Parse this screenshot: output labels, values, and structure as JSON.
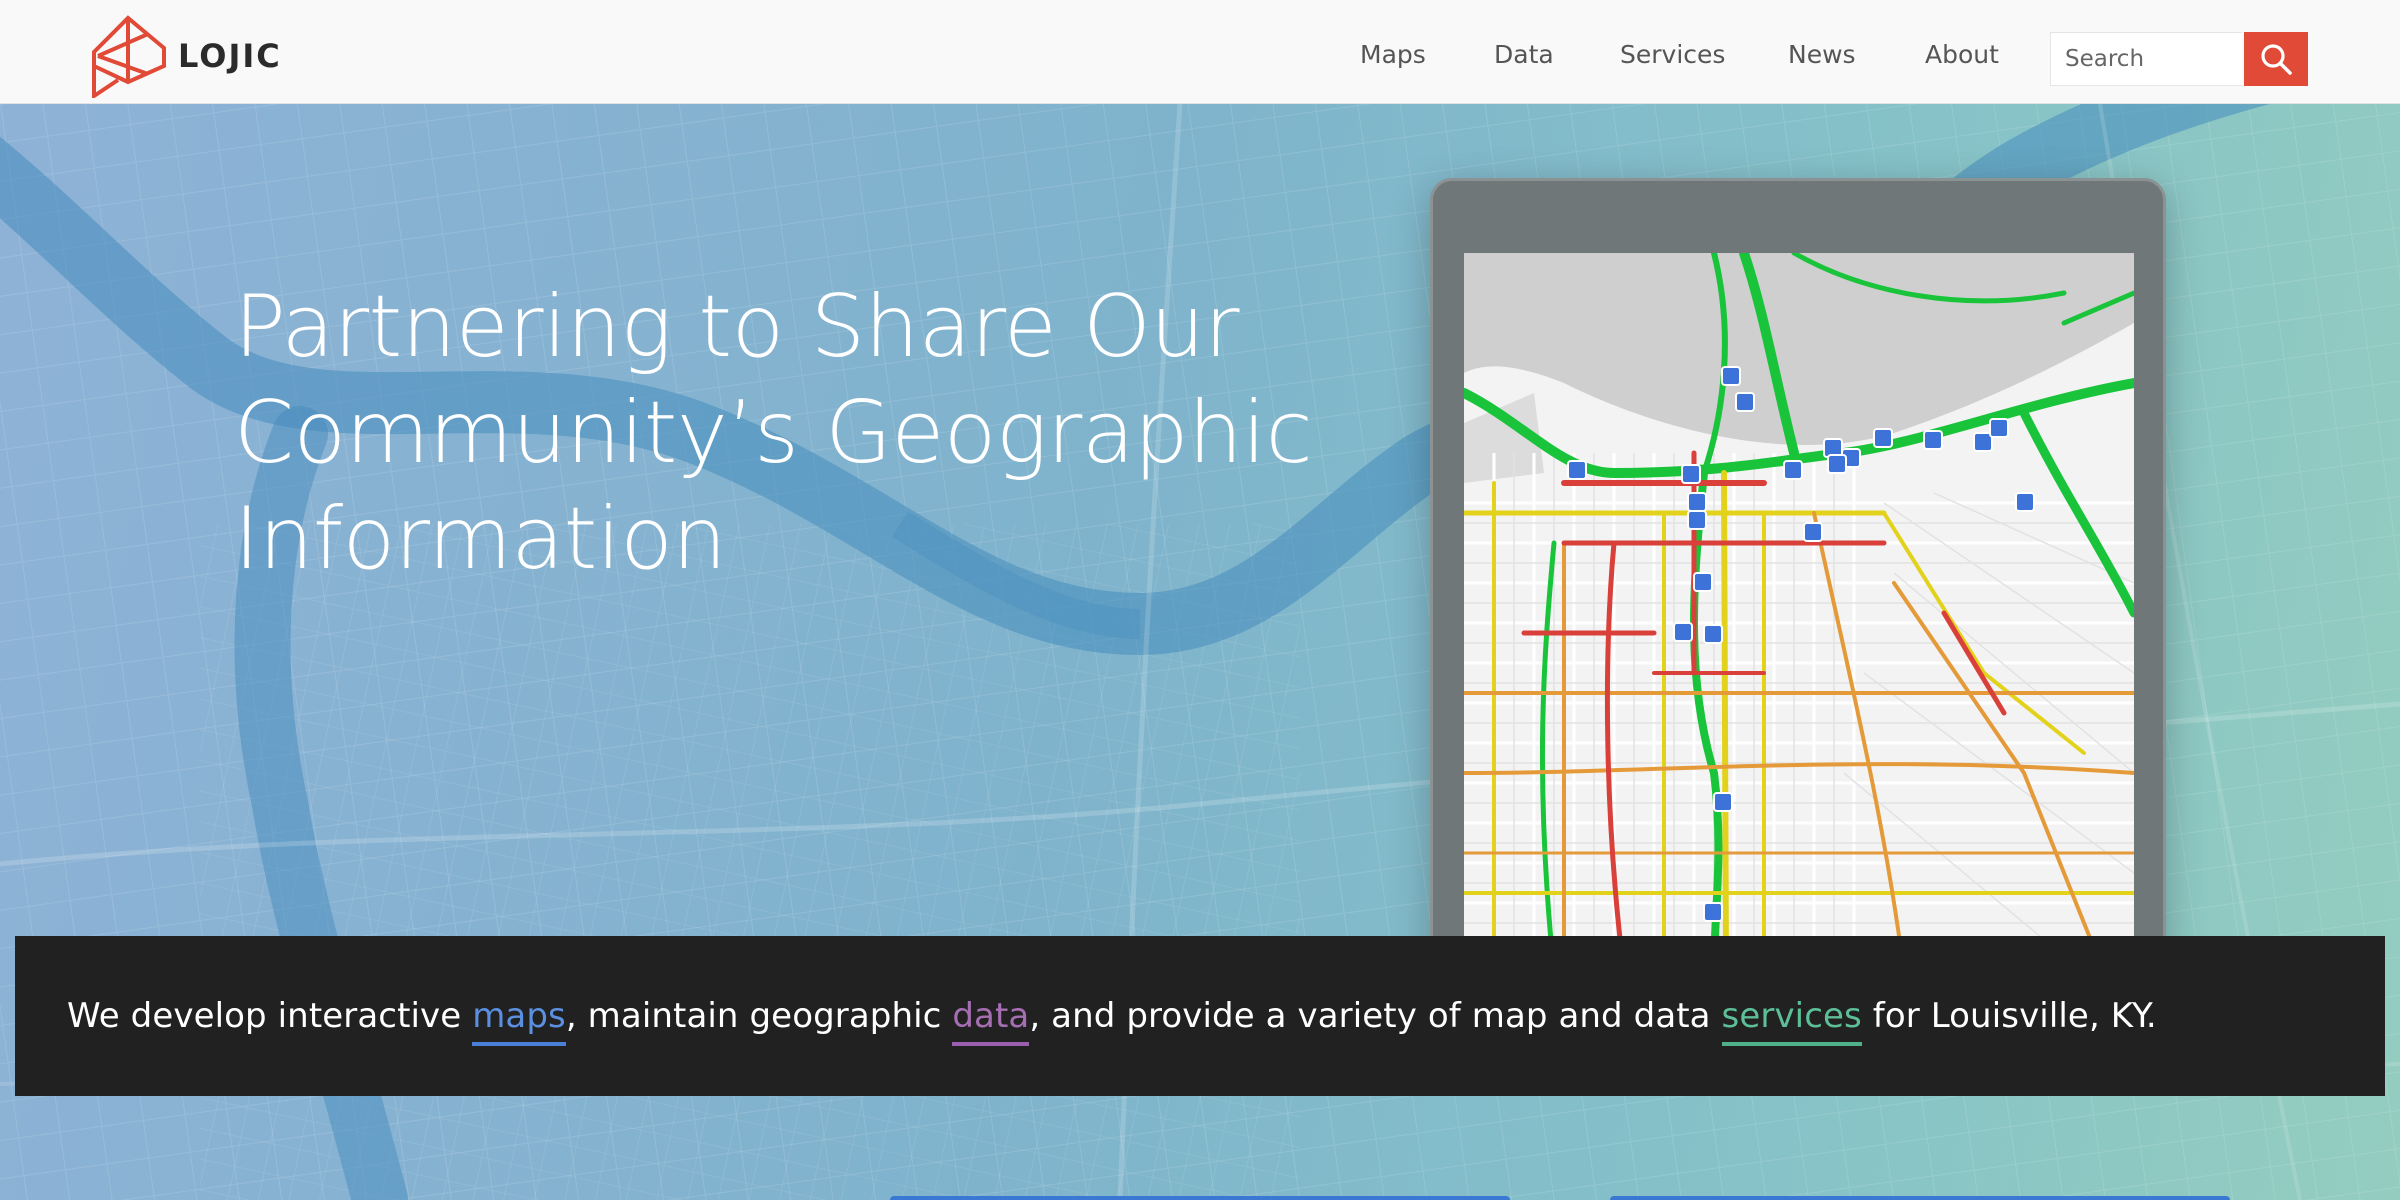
{
  "brand": {
    "name": "LOJIC",
    "logo_color": "#e04a36"
  },
  "nav": {
    "items": [
      {
        "label": "Maps"
      },
      {
        "label": "Data"
      },
      {
        "label": "Services"
      },
      {
        "label": "News"
      },
      {
        "label": "About"
      }
    ],
    "search": {
      "placeholder": "Search",
      "button_icon": "search-icon",
      "button_color": "#e04a36"
    }
  },
  "hero": {
    "headline_lines": [
      "Partnering to Share Our",
      "Community’s Geographic",
      "Information"
    ],
    "tablet_icon": "traffic-map-image"
  },
  "banner": {
    "text_1": "We develop interactive ",
    "link_maps": "maps",
    "text_2": ", maintain geographic ",
    "link_data": "data",
    "text_3": ", and provide a variety of map and data ",
    "link_services": "services",
    "text_4": " for Louisville, KY.",
    "colors": {
      "maps": "#4a7fd8",
      "data": "#9b5fb0",
      "services": "#4fb08a"
    }
  }
}
